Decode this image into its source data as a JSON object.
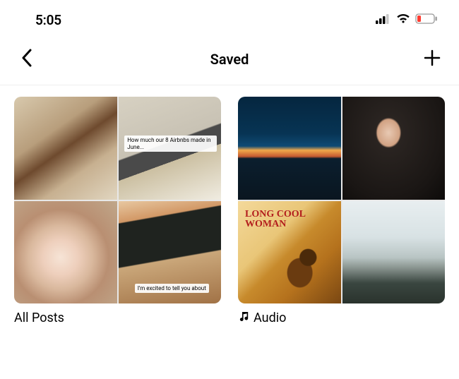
{
  "status": {
    "time": "5:05"
  },
  "header": {
    "title": "Saved"
  },
  "collections": [
    {
      "label": "All Posts",
      "has_icon": false,
      "thumbs": {
        "tl": {
          "overlay": null
        },
        "tr": {
          "overlay": "How much our 8 Airbnbs made in June..."
        },
        "bl": {
          "overlay": null
        },
        "br": {
          "overlay": "I'm excited to tell you about"
        }
      }
    },
    {
      "label": "Audio",
      "has_icon": true,
      "thumbs": {
        "tl": {
          "overlay": null
        },
        "tr": {
          "overlay": null
        },
        "bl": {
          "cover_text": "LONG\nCOOL\nWOMAN"
        },
        "br": {
          "overlay": null
        }
      }
    }
  ]
}
